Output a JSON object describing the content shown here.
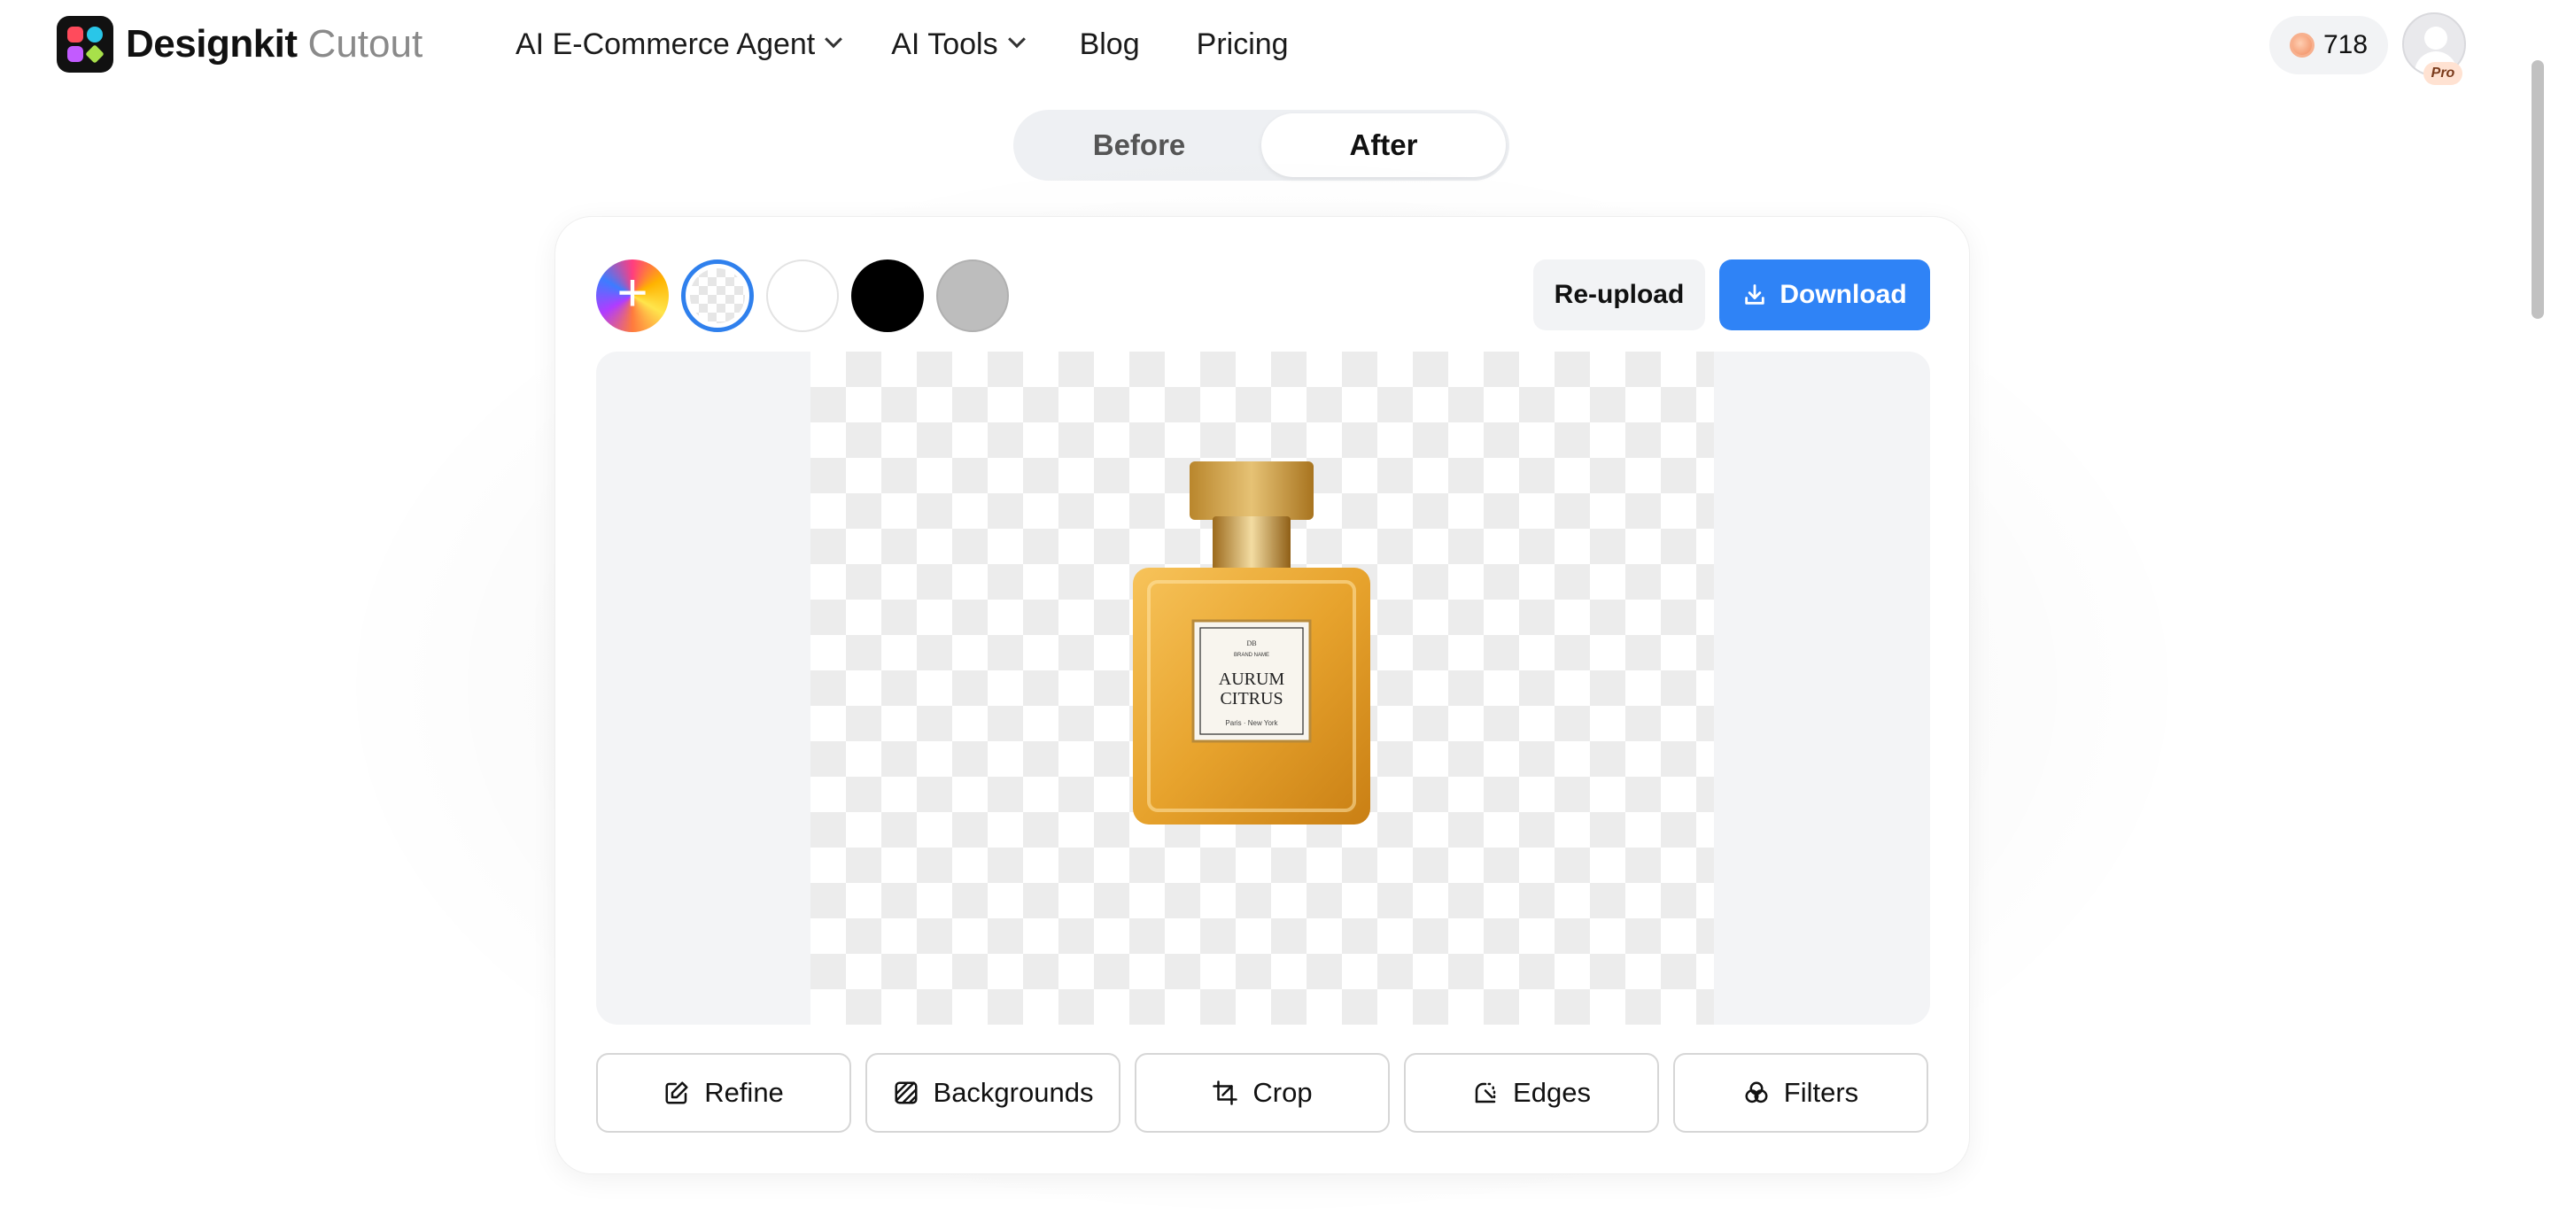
{
  "header": {
    "brand": "Designkit",
    "brand_sub": "Cutout",
    "nav": [
      {
        "label": "AI E-Commerce Agent",
        "has_dropdown": true
      },
      {
        "label": "AI Tools",
        "has_dropdown": true
      },
      {
        "label": "Blog",
        "has_dropdown": false
      },
      {
        "label": "Pricing",
        "has_dropdown": false
      }
    ],
    "credits": "718",
    "avatar_badge": "Pro"
  },
  "toggle": {
    "before": "Before",
    "after": "After",
    "selected": "After"
  },
  "editor": {
    "swatches": [
      {
        "name": "add-color",
        "color": "gradient"
      },
      {
        "name": "transparent",
        "color": "transparent",
        "selected": true
      },
      {
        "name": "white",
        "color": "#ffffff"
      },
      {
        "name": "black",
        "color": "#000000"
      },
      {
        "name": "gray",
        "color": "#bdbdbd"
      }
    ],
    "reupload_label": "Re-upload",
    "download_label": "Download",
    "product_label": {
      "line1": "AURUM",
      "line2": "CITRUS",
      "brand": "BRAND NAME",
      "city": "Paris · New York",
      "mark": "DB"
    },
    "tools": [
      {
        "label": "Refine",
        "icon": "edit-icon"
      },
      {
        "label": "Backgrounds",
        "icon": "pattern-icon"
      },
      {
        "label": "Crop",
        "icon": "crop-icon"
      },
      {
        "label": "Edges",
        "icon": "edges-icon"
      },
      {
        "label": "Filters",
        "icon": "filters-icon"
      }
    ]
  },
  "colors": {
    "accent": "#2f83f6",
    "selected_ring": "#2f80ed"
  }
}
